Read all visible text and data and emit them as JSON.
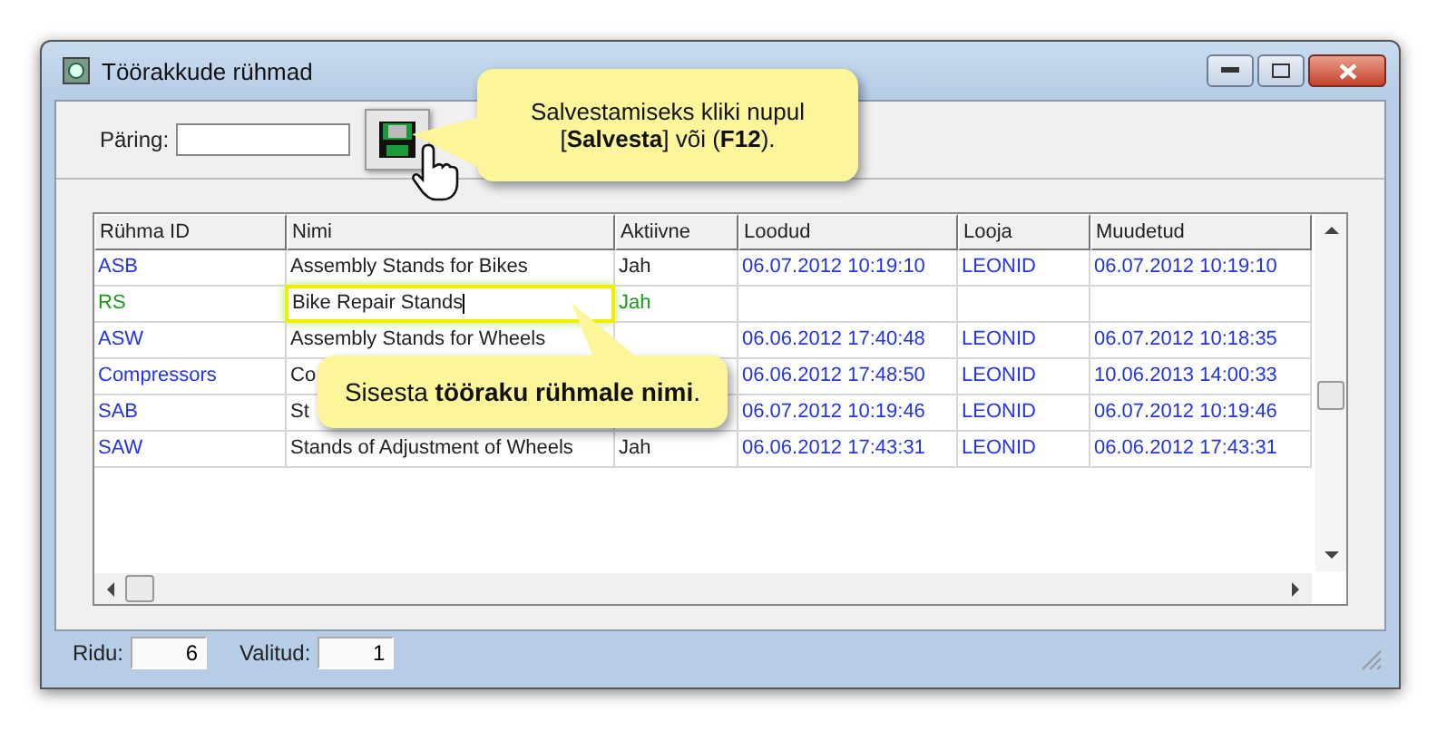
{
  "window": {
    "title": "Töörakkude rühmad"
  },
  "query": {
    "label": "Päring:"
  },
  "callouts": [
    {
      "text": "Salvestamiseks kliki nupul [**Salvesta**] või (**F12**)."
    },
    {
      "text": "Sisesta **tööraku rühmale nimi**."
    }
  ],
  "table": {
    "columns": [
      "Rühma ID",
      "Nimi",
      "Aktiivne",
      "Loodud",
      "Looja",
      "Muudetud"
    ],
    "rows": [
      {
        "selected": false,
        "editing": false,
        "cells": [
          "ASB",
          "Assembly Stands for Bikes",
          "Jah",
          "06.07.2012 10:19:10",
          "LEONID",
          "06.07.2012 10:19:10"
        ]
      },
      {
        "selected": true,
        "editing": true,
        "cells": [
          "RS",
          "Bike Repair Stands",
          "Jah",
          "",
          "",
          ""
        ]
      },
      {
        "selected": false,
        "editing": false,
        "cells": [
          "ASW",
          "Assembly Stands for Wheels",
          "",
          "06.06.2012 17:40:48",
          "LEONID",
          "06.07.2012 10:18:35"
        ]
      },
      {
        "selected": false,
        "editing": false,
        "cells": [
          "Compressors",
          "Co",
          "",
          "06.06.2012 17:48:50",
          "LEONID",
          "10.06.2013 14:00:33"
        ]
      },
      {
        "selected": false,
        "editing": false,
        "cells": [
          "SAB",
          "St",
          "",
          "06.07.2012 10:19:46",
          "LEONID",
          "06.07.2012 10:19:46"
        ]
      },
      {
        "selected": false,
        "editing": false,
        "cells": [
          "SAW",
          "Stands of Adjustment of Wheels",
          "Jah",
          "06.06.2012 17:43:31",
          "LEONID",
          "06.06.2012 17:43:31"
        ]
      }
    ]
  },
  "status_bar": {
    "fields": [
      {
        "label": "Ridu:",
        "value": "6"
      },
      {
        "label": "Valitud:",
        "value": "1"
      }
    ]
  }
}
